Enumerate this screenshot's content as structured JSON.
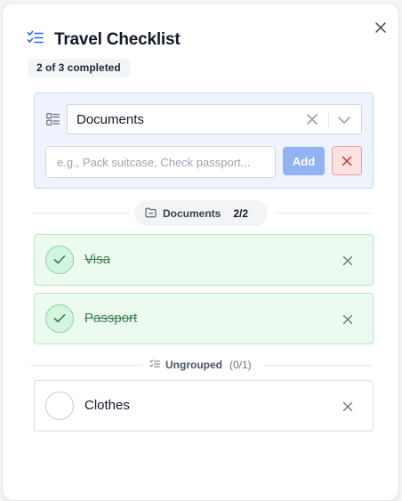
{
  "header": {
    "title": "Travel Checklist",
    "icon": "checklist-icon",
    "accent_color": "#2563eb"
  },
  "summary": {
    "badge": "2 of 3 completed"
  },
  "form": {
    "group_select": {
      "value": "Documents"
    },
    "item_input": {
      "value": "",
      "placeholder": "e.g., Pack suitcase, Check passport..."
    },
    "add_label": "Add"
  },
  "groups": [
    {
      "name": "Documents",
      "progress": "2/2",
      "items": [
        {
          "label": "Visa",
          "done": true
        },
        {
          "label": "Passport",
          "done": true
        }
      ]
    }
  ],
  "ungrouped": {
    "name": "Ungrouped",
    "progress": "(0/1)",
    "items": [
      {
        "label": "Clothes",
        "done": false
      }
    ]
  },
  "colors": {
    "done_bg": "#ecfaf0",
    "done_border": "#b5e8c5",
    "done_text": "#3e7d52",
    "add_button": "#93b2f3",
    "cancel_button": "#fde2e2"
  }
}
